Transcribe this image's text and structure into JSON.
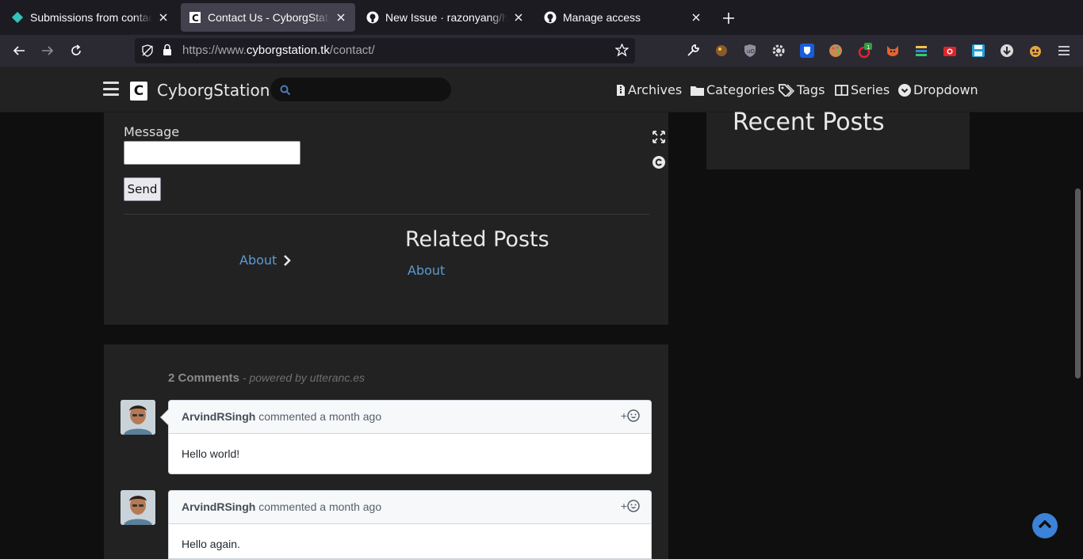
{
  "browser": {
    "tabs": [
      {
        "label": "Submissions from contact",
        "icon": "netlify-icon",
        "active": false
      },
      {
        "label": "Contact Us - CyborgStation",
        "icon": "cyborgstation-favicon",
        "active": true
      },
      {
        "label": "New Issue · razonyang/hu",
        "icon": "github-icon",
        "active": false
      },
      {
        "label": "Manage access",
        "icon": "github-icon",
        "active": false
      }
    ],
    "url_prefix": "https://www.",
    "url_domain": "cyborgstation.tk",
    "url_path": "/contact/"
  },
  "site": {
    "brand": "CyborgStation",
    "logo_letter": "C",
    "search_placeholder": "",
    "menu": [
      {
        "label": "Archives",
        "icon": "file-zip-icon"
      },
      {
        "label": "Categories",
        "icon": "folder-icon"
      },
      {
        "label": "Tags",
        "icon": "tags-icon"
      },
      {
        "label": "Series",
        "icon": "book-icon"
      },
      {
        "label": "Dropdown",
        "icon": "chevron-circle-icon"
      }
    ]
  },
  "form": {
    "message_label": "Message",
    "message_value": "",
    "send_label": "Send"
  },
  "post_nav": {
    "next_label": "About"
  },
  "related": {
    "title": "Related Posts",
    "items": [
      "About"
    ]
  },
  "sidebar": {
    "recent_title": "Recent Posts"
  },
  "comments": {
    "count_label": "2 Comments",
    "powered": "- powered by utteranc.es",
    "items": [
      {
        "author": "ArvindRSingh",
        "action": "commented",
        "time": "a month ago",
        "body": "Hello world!",
        "react": "+"
      },
      {
        "author": "ArvindRSingh",
        "action": "commented",
        "time": "a month ago",
        "body": "Hello again.",
        "react": "+"
      }
    ]
  },
  "colors": {
    "link": "#5b9bd5",
    "page_bg": "#0f0f0f",
    "card_bg": "#222222",
    "accent": "#3b82d8"
  }
}
